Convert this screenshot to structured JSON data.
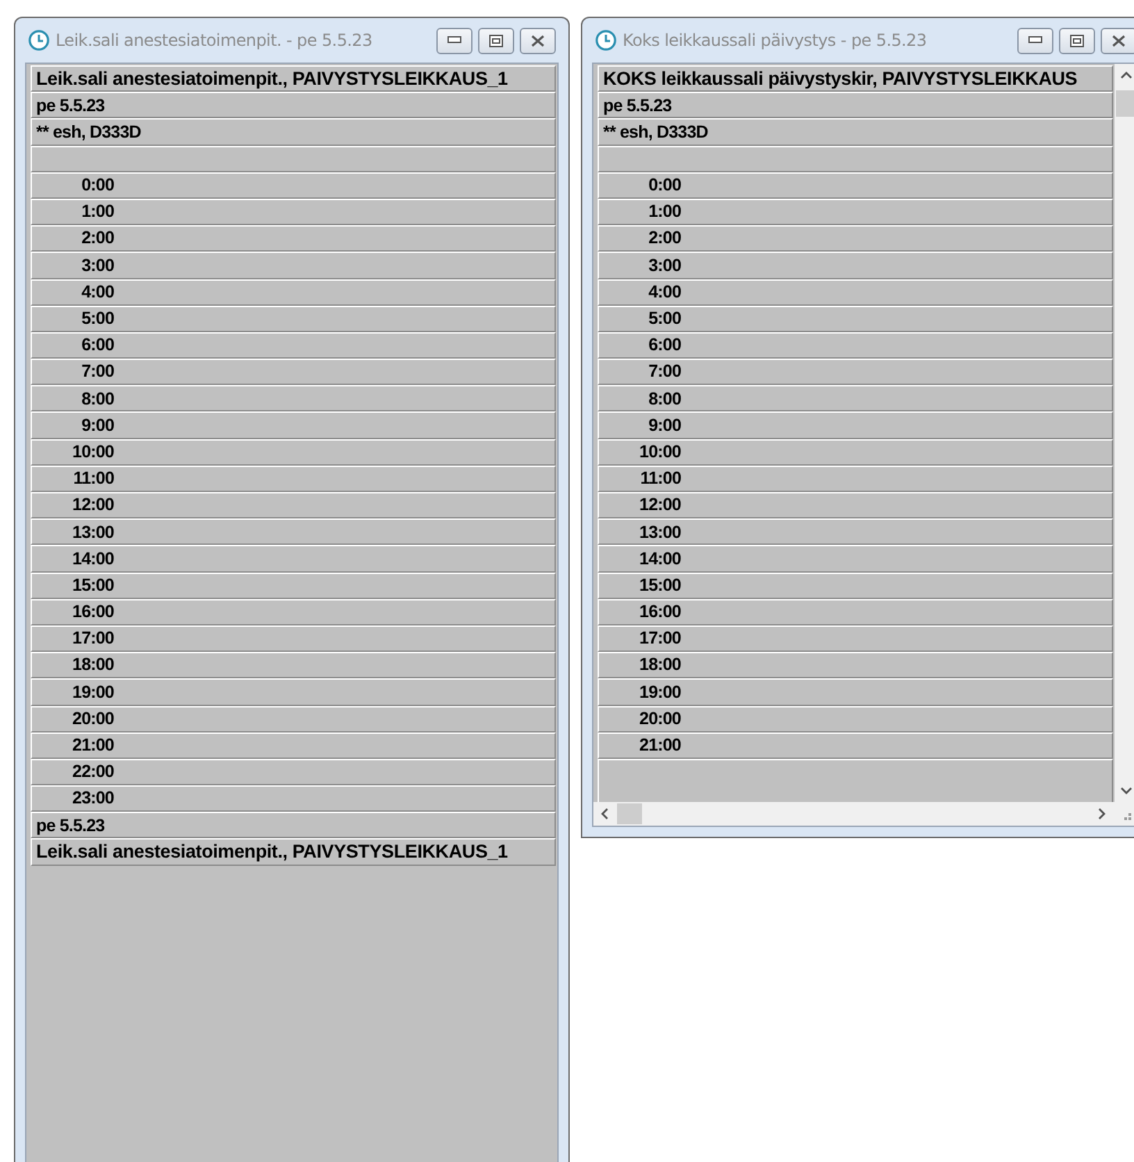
{
  "windows": [
    {
      "title": "Leik.sali anestesiatoimenpit. - pe 5.5.23",
      "scrollbars": false,
      "rows": [
        {
          "kind": "header",
          "text": "Leik.sali anestesiatoimenpit., PAIVYSTYSLEIKKAUS_1"
        },
        {
          "kind": "text",
          "text": "pe 5.5.23"
        },
        {
          "kind": "text",
          "text": "** esh, D333D"
        },
        {
          "kind": "blank"
        },
        {
          "kind": "hour",
          "text": "0:00"
        },
        {
          "kind": "hour",
          "text": "1:00"
        },
        {
          "kind": "hour",
          "text": "2:00"
        },
        {
          "kind": "hour",
          "text": "3:00"
        },
        {
          "kind": "hour",
          "text": "4:00"
        },
        {
          "kind": "hour",
          "text": "5:00"
        },
        {
          "kind": "hour",
          "text": "6:00"
        },
        {
          "kind": "hour",
          "text": "7:00"
        },
        {
          "kind": "hour",
          "text": "8:00"
        },
        {
          "kind": "hour",
          "text": "9:00"
        },
        {
          "kind": "hour",
          "text": "10:00"
        },
        {
          "kind": "hour",
          "text": "11:00"
        },
        {
          "kind": "hour",
          "text": "12:00"
        },
        {
          "kind": "hour",
          "text": "13:00"
        },
        {
          "kind": "hour",
          "text": "14:00"
        },
        {
          "kind": "hour",
          "text": "15:00"
        },
        {
          "kind": "hour",
          "text": "16:00"
        },
        {
          "kind": "hour",
          "text": "17:00"
        },
        {
          "kind": "hour",
          "text": "18:00"
        },
        {
          "kind": "hour",
          "text": "19:00"
        },
        {
          "kind": "hour",
          "text": "20:00"
        },
        {
          "kind": "hour",
          "text": "21:00"
        },
        {
          "kind": "hour",
          "text": "22:00"
        },
        {
          "kind": "hour",
          "text": "23:00"
        },
        {
          "kind": "text",
          "text": "pe 5.5.23"
        },
        {
          "kind": "header",
          "text": "Leik.sali anestesiatoimenpit., PAIVYSTYSLEIKKAUS_1"
        }
      ]
    },
    {
      "title": "Koks leikkaussali päivystys - pe 5.5.23",
      "scrollbars": true,
      "rows": [
        {
          "kind": "header",
          "text": "KOKS leikkaussali päivystyskir, PAIVYSTYSLEIKKAUS"
        },
        {
          "kind": "text",
          "text": "pe 5.5.23"
        },
        {
          "kind": "text",
          "text": "** esh, D333D"
        },
        {
          "kind": "blank"
        },
        {
          "kind": "hour",
          "text": "0:00"
        },
        {
          "kind": "hour",
          "text": "1:00"
        },
        {
          "kind": "hour",
          "text": "2:00"
        },
        {
          "kind": "hour",
          "text": "3:00"
        },
        {
          "kind": "hour",
          "text": "4:00"
        },
        {
          "kind": "hour",
          "text": "5:00"
        },
        {
          "kind": "hour",
          "text": "6:00"
        },
        {
          "kind": "hour",
          "text": "7:00"
        },
        {
          "kind": "hour",
          "text": "8:00"
        },
        {
          "kind": "hour",
          "text": "9:00"
        },
        {
          "kind": "hour",
          "text": "10:00"
        },
        {
          "kind": "hour",
          "text": "11:00"
        },
        {
          "kind": "hour",
          "text": "12:00"
        },
        {
          "kind": "hour",
          "text": "13:00"
        },
        {
          "kind": "hour",
          "text": "14:00"
        },
        {
          "kind": "hour",
          "text": "15:00"
        },
        {
          "kind": "hour",
          "text": "16:00"
        },
        {
          "kind": "hour",
          "text": "17:00"
        },
        {
          "kind": "hour",
          "text": "18:00"
        },
        {
          "kind": "hour",
          "text": "19:00"
        },
        {
          "kind": "hour",
          "text": "20:00"
        },
        {
          "kind": "hour",
          "text": "21:00"
        }
      ]
    }
  ]
}
